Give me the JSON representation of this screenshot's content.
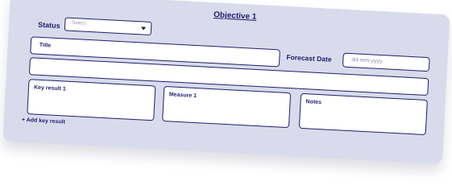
{
  "objective": {
    "title": "Objective 1"
  },
  "status": {
    "label": "Status",
    "selected": "-Select-"
  },
  "title_field": {
    "label": "Title"
  },
  "forecast": {
    "label": "Forecast Date",
    "placeholder": "dd-mm-yyyy"
  },
  "key_result": {
    "label": "Key result 1"
  },
  "measure": {
    "label": "Measure 1"
  },
  "notes": {
    "label": "Notes"
  },
  "add_key_result": "+ Add key result"
}
